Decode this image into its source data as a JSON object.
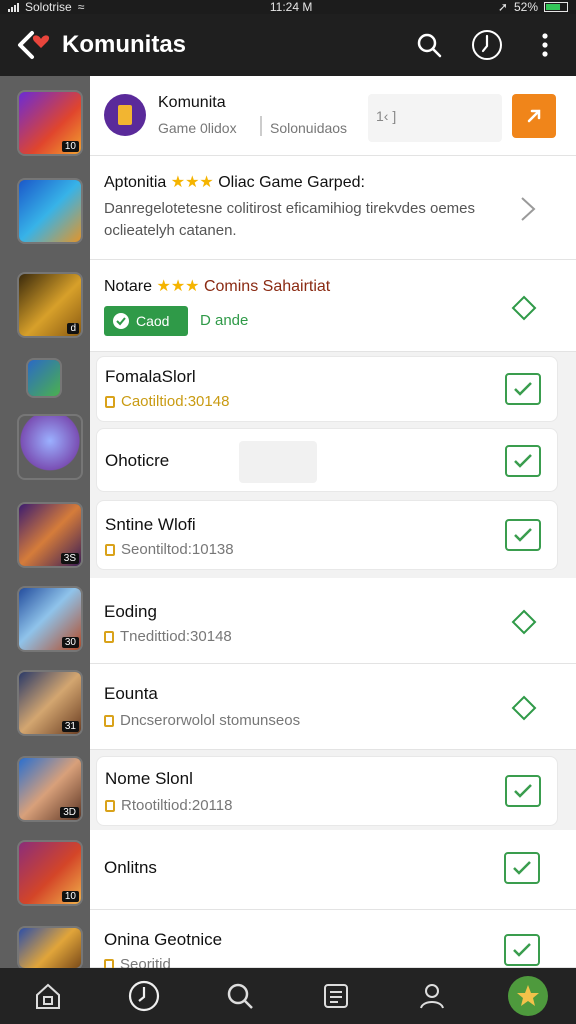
{
  "status": {
    "carrier": "Solotrise",
    "time": "11:24 M",
    "battery": "52%"
  },
  "header": {
    "title": "Komunitas"
  },
  "rows": [
    {
      "name": "Komunita",
      "sub": "Game 0lidox",
      "sub2": "Solonuidaos",
      "field": "1‹ ]"
    },
    {
      "name_prefix": "Aptonitia",
      "stars": "★★★",
      "name_suffix": "Oliac Game Garped:",
      "desc": "Danregelotetesne colitirost eficamihiog tirekvdes oemes oclieatelyh catanen."
    },
    {
      "name_prefix": "Notare",
      "stars": "★★★",
      "name_suffix": "Comins Sahairtiat",
      "btn": "Caod",
      "btn2": "D ande"
    },
    {
      "name": "FomalaSlorl",
      "sub": "Caotiltiod:30148"
    },
    {
      "name": "Ohoticre"
    },
    {
      "name": "Sntine Wlofi",
      "sub": "Seontiltod:10138"
    },
    {
      "name": "Eoding",
      "sub": "Tnedittiod:30148"
    },
    {
      "name": "Eounta",
      "sub": "Dncserorwolol stomunseos"
    },
    {
      "name": "Nome Slonl",
      "sub": "Rtootiltiod:20118"
    },
    {
      "name": "Onlitns"
    },
    {
      "name": "Onina Geotnice",
      "sub": "Seoritid"
    }
  ],
  "avatar_badges": [
    "10",
    "",
    "d",
    "",
    "",
    "3S",
    "30",
    "31",
    "3D",
    "10",
    ""
  ],
  "colors": {
    "accent": "#f0851a",
    "green": "#3a9d4e",
    "gold": "#d9a21a",
    "heart": "#e8453c"
  }
}
